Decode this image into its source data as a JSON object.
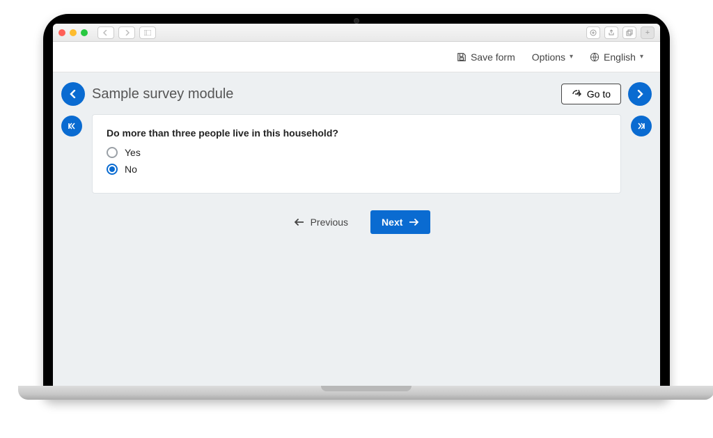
{
  "toolbar": {
    "save_label": "Save form",
    "options_label": "Options",
    "language_label": "English"
  },
  "page": {
    "title": "Sample survey module",
    "goto_label": "Go to"
  },
  "question": {
    "text": "Do more than three people live in this household?",
    "options": [
      {
        "label": "Yes",
        "selected": false
      },
      {
        "label": "No",
        "selected": true
      }
    ]
  },
  "footer": {
    "prev_label": "Previous",
    "next_label": "Next"
  }
}
